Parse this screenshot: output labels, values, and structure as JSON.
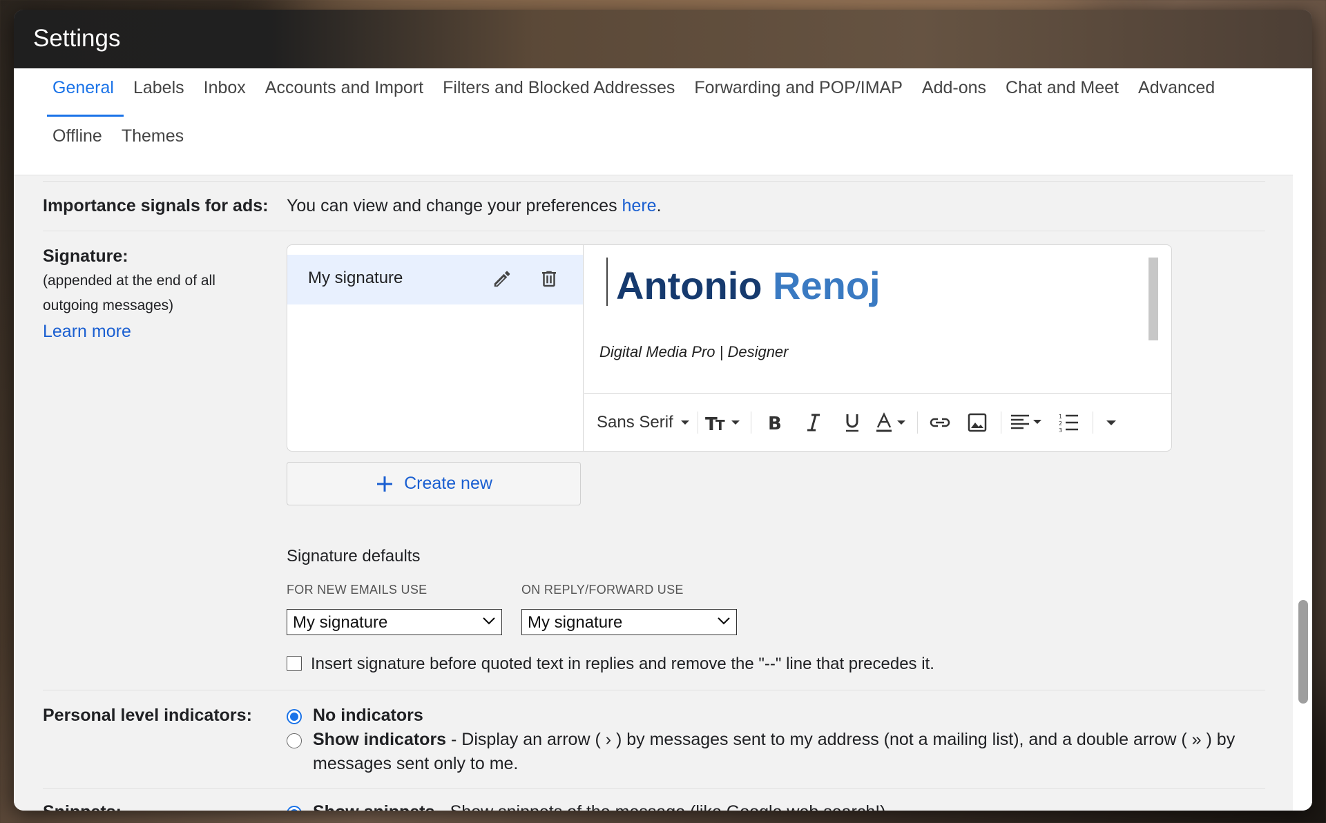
{
  "window": {
    "title": "Settings"
  },
  "tabs": {
    "row1": [
      "General",
      "Labels",
      "Inbox",
      "Accounts and Import",
      "Filters and Blocked Addresses",
      "Forwarding and POP/IMAP",
      "Add-ons",
      "Chat and Meet",
      "Advanced"
    ],
    "row2": [
      "Offline",
      "Themes"
    ],
    "active": "General"
  },
  "importance": {
    "label": "Importance signals for ads:",
    "text": "You can view and change your preferences ",
    "link": "here",
    "period": "."
  },
  "signature": {
    "label": "Signature:",
    "desc_line1": "(appended at the end of all",
    "desc_line2": "outgoing messages)",
    "learn_more": "Learn more",
    "list_item": "My signature",
    "name_first": "Antonio",
    "name_last": "Renoj",
    "tagline": "Digital Media Pro | Designer",
    "toolbar_font": "Sans Serif",
    "create_new": "Create new",
    "defaults_title": "Signature defaults",
    "new_emails_label": "FOR NEW EMAILS USE",
    "reply_label": "ON REPLY/FORWARD USE",
    "new_emails_value": "My signature",
    "reply_value": "My signature",
    "insert_before": "Insert signature before quoted text in replies and remove the \"--\" line that precedes it."
  },
  "personal_level": {
    "label": "Personal level indicators:",
    "opt1": "No indicators",
    "opt2_bold": "Show indicators",
    "opt2_text": " - Display an arrow ( › ) by messages sent to my address (not a mailing list), and a double arrow ( » ) by",
    "opt2_cont": "messages sent only to me."
  },
  "snippets": {
    "label": "Snippets:",
    "opt1_bold": "Show snippets",
    "opt1_text": " - Show snippets of the message (like Google web search!)."
  },
  "colors": {
    "accent": "#1a73e8",
    "link": "#1a5fd1",
    "sig_first": "#163a6e",
    "sig_last": "#3a7ac2"
  }
}
